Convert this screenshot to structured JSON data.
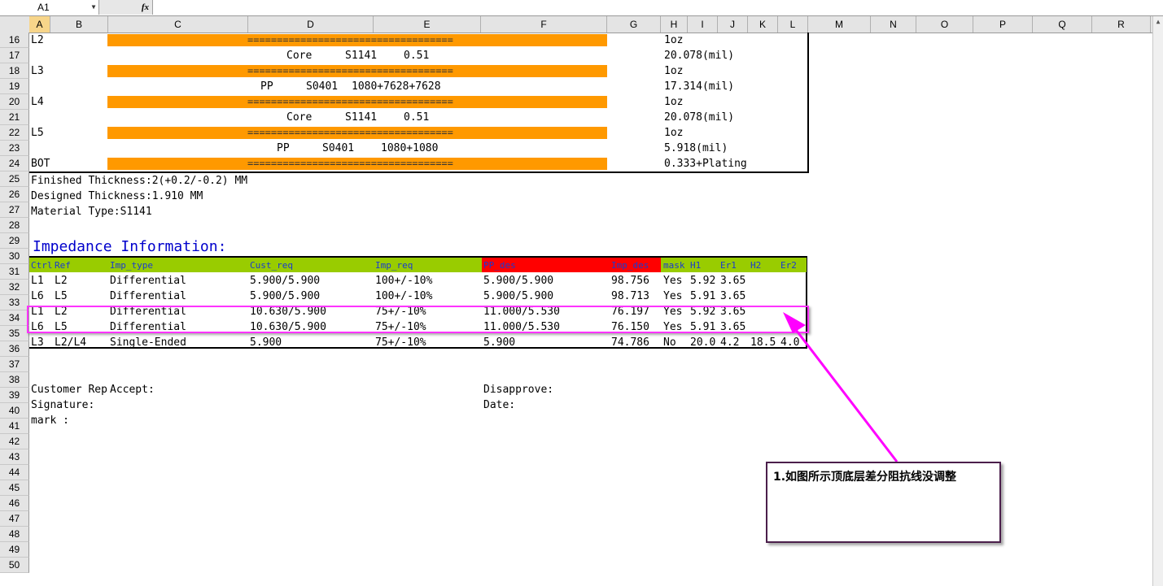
{
  "formula_bar": {
    "cell_ref": "A1",
    "fx": "fx",
    "dropdown": "▼"
  },
  "columns": [
    "A",
    "B",
    "C",
    "D",
    "E",
    "F",
    "G",
    "H",
    "I",
    "J",
    "K",
    "L",
    "M",
    "N",
    "O",
    "P",
    "Q",
    "R"
  ],
  "rows": [
    "16",
    "17",
    "18",
    "19",
    "20",
    "21",
    "22",
    "23",
    "24",
    "25",
    "26",
    "27",
    "28",
    "29",
    "30",
    "31",
    "32",
    "33",
    "34",
    "35",
    "36",
    "37",
    "38",
    "39",
    "40",
    "41",
    "42",
    "43",
    "44",
    "45",
    "46",
    "47",
    "48",
    "49",
    "50"
  ],
  "stackup": {
    "eq_line": "===================================",
    "rows": [
      {
        "layer": "L2",
        "weight": "1oz"
      },
      {
        "material": "Core",
        "spec": "S1141",
        "value": "0.51",
        "thickness": "20.078(mil)"
      },
      {
        "layer": "L3",
        "weight": "1oz"
      },
      {
        "material": "PP",
        "spec": "S0401",
        "value": "1080+7628+7628",
        "thickness": "17.314(mil)"
      },
      {
        "layer": "L4",
        "weight": "1oz"
      },
      {
        "material": "Core",
        "spec": "S1141",
        "value": "0.51",
        "thickness": "20.078(mil)"
      },
      {
        "layer": "L5",
        "weight": "1oz"
      },
      {
        "material": "PP",
        "spec": "S0401",
        "value": "1080+1080",
        "thickness": "5.918(mil)"
      },
      {
        "layer": "BOT",
        "weight": "0.333+Plating"
      }
    ]
  },
  "info": {
    "finished": "Finished Thickness:2(+0.2/-0.2) MM",
    "designed": "Designed Thickness:1.910 MM",
    "material": "Material Type:S1141"
  },
  "impedance": {
    "title": "Impedance Information:",
    "headers": {
      "ctrl": "Ctrl",
      "ref": "Ref",
      "imp_type": "Imp_type",
      "cust_req": "Cust_req",
      "imp_req": "Imp_req",
      "pp_des": "PP_des",
      "imp_des": "Imp_des",
      "mask": "mask",
      "h1": "H1",
      "er1": "Er1",
      "h2": "H2",
      "er2": "Er2"
    },
    "rows": [
      {
        "ctrl": "L1",
        "ref": "L2",
        "type": "Differential",
        "cust": "5.900/5.900",
        "req": "100+/-10%",
        "pp": "5.900/5.900",
        "imp": "98.756",
        "mask": "Yes",
        "h1": "5.92",
        "er1": "3.65",
        "h2": "",
        "er2": ""
      },
      {
        "ctrl": "L6",
        "ref": "L5",
        "type": "Differential",
        "cust": "5.900/5.900",
        "req": "100+/-10%",
        "pp": "5.900/5.900",
        "imp": "98.713",
        "mask": "Yes",
        "h1": "5.91",
        "er1": "3.65",
        "h2": "",
        "er2": ""
      },
      {
        "ctrl": "L1",
        "ref": "L2",
        "type": "Differential",
        "cust": "10.630/5.900",
        "req": "75+/-10%",
        "pp": "11.000/5.530",
        "imp": "76.197",
        "mask": "Yes",
        "h1": "5.92",
        "er1": "3.65",
        "h2": "",
        "er2": ""
      },
      {
        "ctrl": "L6",
        "ref": "L5",
        "type": "Differential",
        "cust": "10.630/5.900",
        "req": "75+/-10%",
        "pp": "11.000/5.530",
        "imp": "76.150",
        "mask": "Yes",
        "h1": "5.91",
        "er1": "3.65",
        "h2": "",
        "er2": ""
      },
      {
        "ctrl": "L3",
        "ref": "L2/L4",
        "type": "Single-Ended",
        "cust": "5.900",
        "req": "75+/-10%",
        "pp": "5.900",
        "imp": "74.786",
        "mask": "No",
        "h1": "20.0",
        "er1": "4.2",
        "h2": "18.5",
        "er2": "4.0"
      }
    ]
  },
  "signoff": {
    "customer": "Customer Rep",
    "accept": "Accept:",
    "disapprove": "Disapprove:",
    "signature": "Signature:",
    "date": "Date:",
    "remark": "mark :"
  },
  "annotation": {
    "text": "1.如图所示顶底层差分阻抗线没调整"
  },
  "colors": {
    "orange": "#ff9900",
    "green": "#99cc00",
    "red": "#ff0000",
    "blue": "#0000cc",
    "magenta": "#ff00ff",
    "callout_border": "#4b1f4b"
  }
}
